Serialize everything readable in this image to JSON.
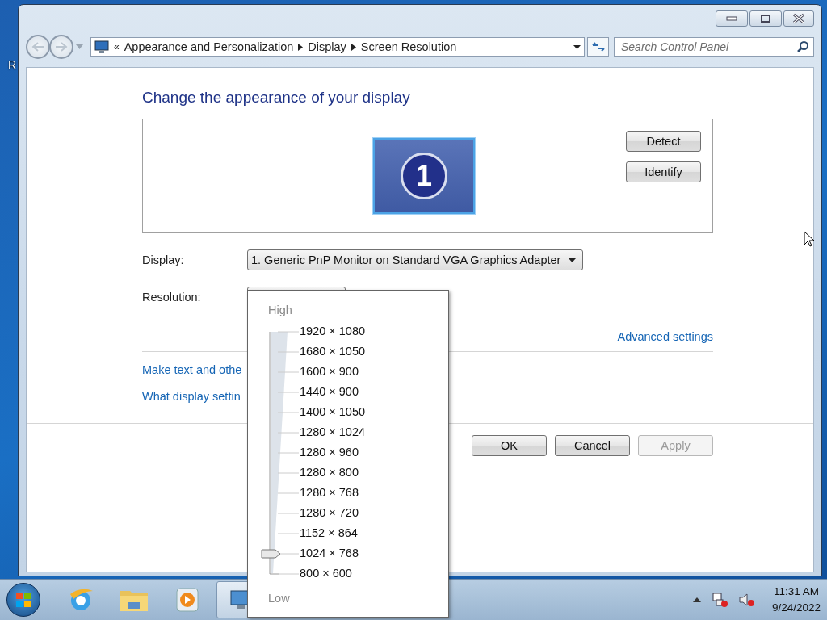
{
  "desktop": {
    "icon_label": "R"
  },
  "address_bar": {
    "overflow": "«",
    "crumbs": [
      "Appearance and Personalization",
      "Display",
      "Screen Resolution"
    ]
  },
  "search": {
    "placeholder": "Search Control Panel"
  },
  "heading": "Change the appearance of your display",
  "preview": {
    "monitor_number": "1",
    "buttons": [
      "Detect",
      "Identify"
    ]
  },
  "fields": [
    {
      "kind": "select",
      "label": "Display:",
      "value": "1. Generic PnP Monitor on Standard VGA Graphics Adapter"
    },
    {
      "kind": "covered",
      "label": "Resolution:"
    }
  ],
  "advanced_link": "Advanced settings",
  "links": [
    "Make text and othe",
    "What display settin"
  ],
  "dialog_buttons": [
    {
      "label": "OK",
      "disabled": false
    },
    {
      "label": "Cancel",
      "disabled": false
    },
    {
      "label": "Apply",
      "disabled": true
    }
  ],
  "resolution_menu": {
    "high_label": "High",
    "low_label": "Low",
    "level": 0.0833,
    "options": [
      "1920 × 1080",
      "1680 × 1050",
      "1600 × 900",
      "1440 × 900",
      "1400 × 1050",
      "1280 × 1024",
      "1280 × 960",
      "1280 × 800",
      "1280 × 768",
      "1280 × 720",
      "1152 × 864",
      "1024 × 768",
      "800 × 600"
    ]
  },
  "taskbar": {
    "apps": [
      {
        "kind": "browser",
        "active": false
      },
      {
        "kind": "folder",
        "active": false
      },
      {
        "kind": "player",
        "active": false
      },
      {
        "kind": "display",
        "active": true
      }
    ]
  },
  "tray": {
    "time": "11:31 AM",
    "date": "9/24/2022"
  }
}
